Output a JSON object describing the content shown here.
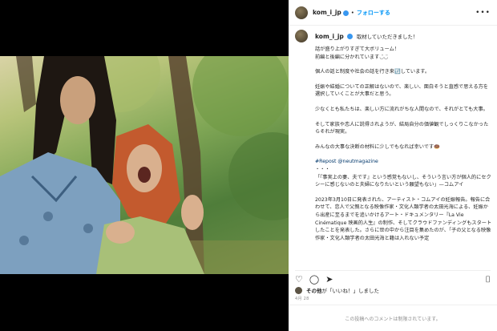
{
  "post": {
    "username": "kom_i_jp",
    "follow_label": "フォローする",
    "caption_lead": "取材していただきました！",
    "caption_lines": [
      "話が盛り上がりすぎて大ボリューム！",
      "前編と後編に分かれています◡̈◡̈",
      "個人の話と制度や社会の話を行き来🔃しています。",
      "妊娠や結婚についての正解はないので、楽しい、面白そうと直感で思える方を選択していくことが大事だと思う。",
      "少なくとも私たちは、楽しい方に流れがちな人間なので、それがとても大事。",
      "そして家族や恋人に説得されようが、結局自分の価値観でしっくりこなかったらそれが現実。",
      "みんなの大事な決断の材料に少しでもなれば幸いです🍩",
      "#Repost @neutmagazine",
      "・・・",
      "「『事実上の妻、夫です』という感覚もないし、そういう言い方が個人的にセクシーに感じないのと夫婦になりたいという願望もない」—コムアイ",
      "2023年3月10日に発表された、アーティスト・コムアイの妊娠報告。報告に合わせて、恋人で父親となる映像作家・文化人類学者の太田光海による、妊娠から出産に至るまでを追いかけるアート・ドキュメンタリー『La Vie Cinématique 映画的人生』の制作、そしてクラウドファンディングもスタートしたことを発表した。さらに世の中から注目を集めたのが、「子の父となる映像作家・文化人類学者の太田光海と籍は入れない予定"
    ],
    "likes_text_bold": "その他",
    "likes_text_rest": "が「いいね！」しました",
    "date": "4月 28",
    "comment_notice": "この投稿へのコメントは制限されています。"
  },
  "icons": {
    "more": "more-horizontal-icon",
    "like": "heart-icon",
    "comment": "comment-icon",
    "share": "paper-plane-icon",
    "save": "bookmark-icon"
  },
  "colors": {
    "link": "#0095f6",
    "hashtag": "#00376b",
    "verified": "#3897f0"
  }
}
